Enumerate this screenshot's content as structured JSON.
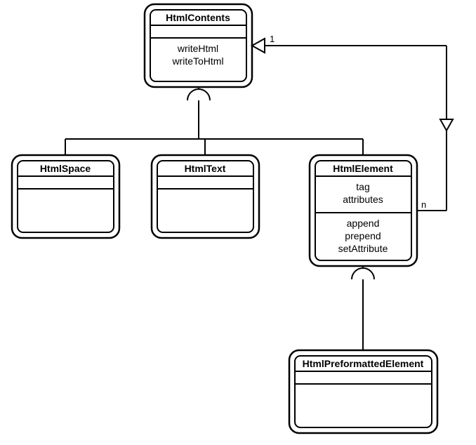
{
  "classes": {
    "htmlContents": {
      "name": "HtmlContents",
      "methods": [
        "writeHtml",
        "writeToHtml"
      ]
    },
    "htmlSpace": {
      "name": "HtmlSpace"
    },
    "htmlText": {
      "name": "HtmlText"
    },
    "htmlElement": {
      "name": "HtmlElement",
      "attrs": [
        "tag",
        "attributes"
      ],
      "methods": [
        "append",
        "prepend",
        "setAttribute"
      ]
    },
    "htmlPreformattedElement": {
      "name": "HtmlPreformattedElement"
    }
  },
  "associations": {
    "elementToContents": {
      "endA_multiplicity": "1",
      "endB_multiplicity": "n"
    }
  }
}
